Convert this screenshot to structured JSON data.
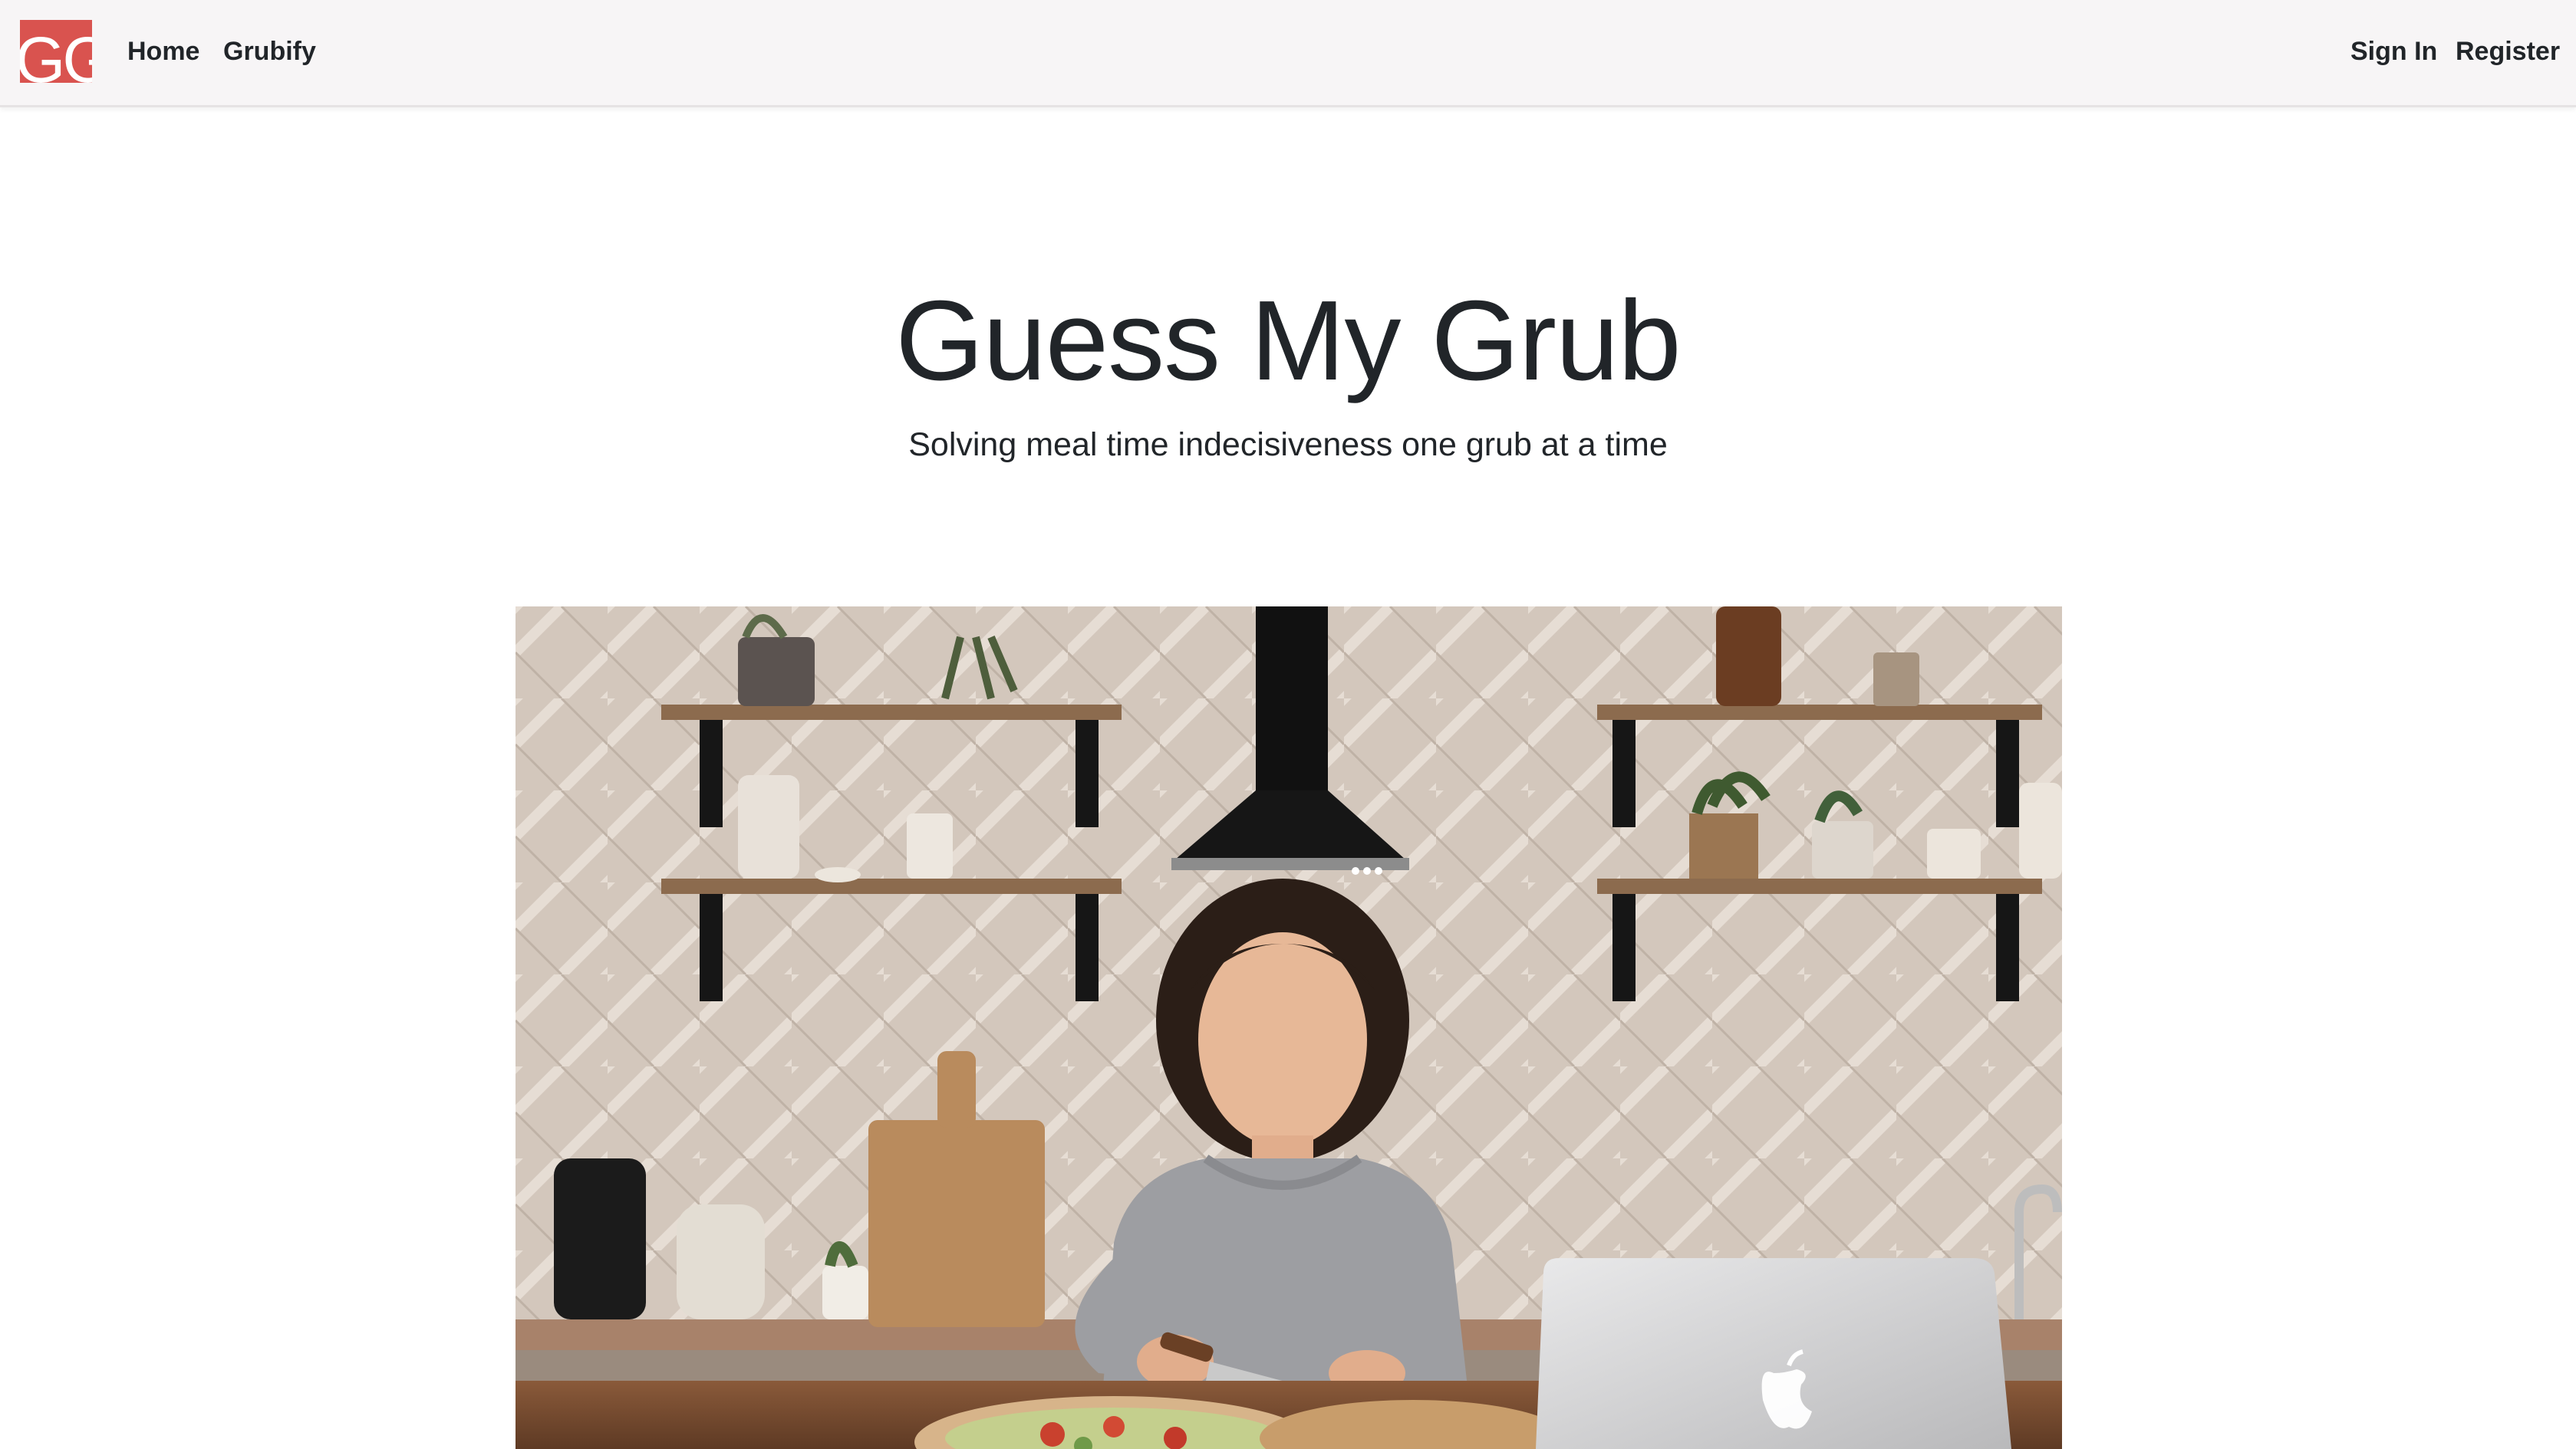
{
  "navbar": {
    "brand": {
      "logo_text": "GG",
      "logo_color": "#d9534f"
    },
    "links": {
      "home": "Home",
      "grubify": "Grubify"
    },
    "auth": {
      "sign_in": "Sign In",
      "register": "Register"
    }
  },
  "hero": {
    "title": "Guess My Grub",
    "subtitle": "Solving meal time indecisiveness one grub at a time"
  },
  "photo": {
    "subject": "woman chopping vegetables at a kitchen counter with a laptop"
  }
}
